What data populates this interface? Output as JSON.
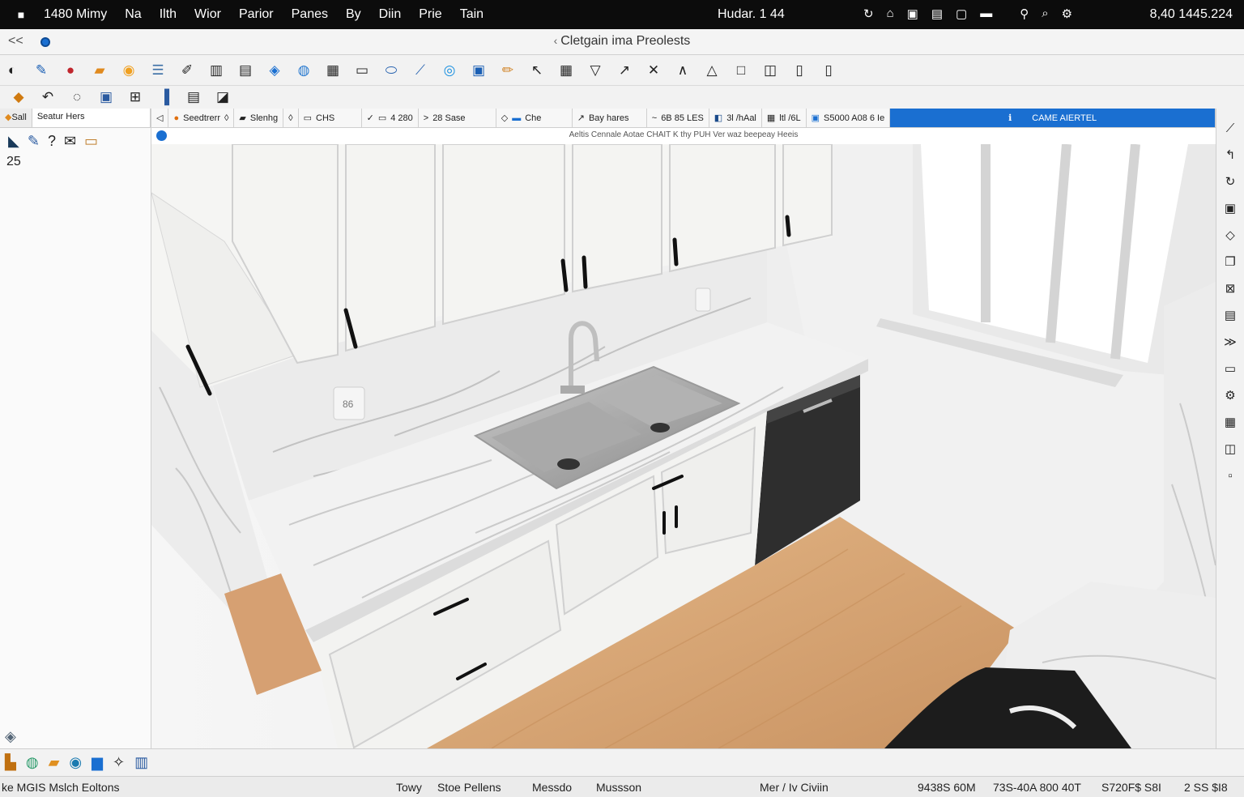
{
  "menubar": {
    "items": [
      "1480 Mimy",
      "Na",
      "Ilth",
      "Wior",
      "Parior",
      "Panes",
      "By",
      "Diin",
      "Prie",
      "Tain"
    ],
    "center": "Hudar. 1 44",
    "clock": "8,40 1445.224"
  },
  "window": {
    "title": "Cletgain ima Preolests"
  },
  "left_panel": {
    "tabs": [
      "Sall",
      "Seatur Hers"
    ],
    "number": "25"
  },
  "options_bar": {
    "items": [
      "Seedtrerr",
      "Slenhg",
      "CHS",
      "4 280",
      "28 Sase",
      "Che",
      "Bay hares",
      "6B 85 LES",
      "3l /hAal",
      "ltl /6L",
      "S5000 A08 6 Ie"
    ],
    "action": "CAME AIERTEL"
  },
  "view_header": {
    "text": "Aeltis Cennale Aotae CHAIT K thy PUH Ver waz beepeay Heeis"
  },
  "outlet_label": "86",
  "status": {
    "left": "ke  MGIS Mslch Eoltons",
    "tow": "Towy",
    "stoe": "Stoe Pellens",
    "messdo": "Messdo",
    "mussson": "Mussson",
    "mer": "Mer / Iv Civiin",
    "c1": "9438S 60M",
    "c2": "73S-40A 800 40T",
    "c3": "S720F$ S8I",
    "c4": "2 SS $I8"
  },
  "colors": {
    "accent": "#1a6fd1",
    "menubar": "#0c0c0c",
    "floor": "#d8a878",
    "cabinet": "#f4f4f2"
  }
}
